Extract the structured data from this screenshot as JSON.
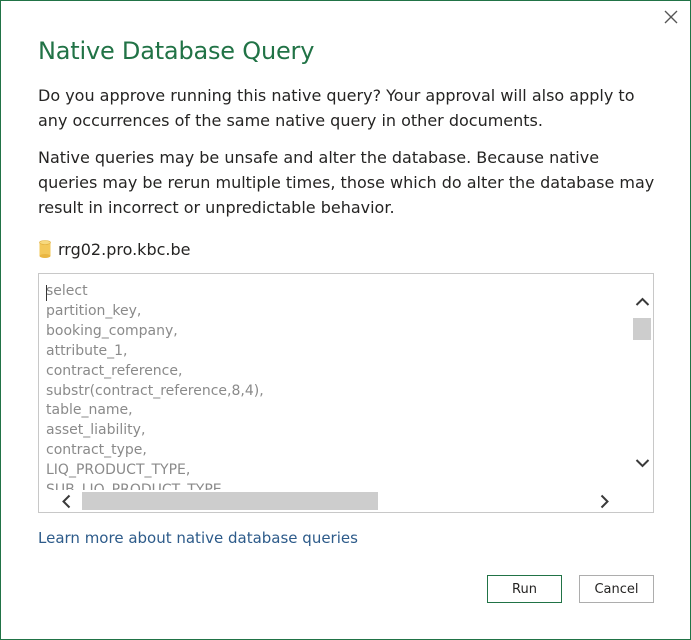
{
  "dialog": {
    "title": "Native Database Query",
    "approval_text": "Do you approve running this native query? Your approval will also apply to any occurrences of the same native query in other documents.",
    "warning_text": "Native queries may be unsafe and alter the database. Because native queries may be rerun multiple times, those which do alter the database may result in incorrect or unpredictable behavior.",
    "server": {
      "icon": "database-cylinder-icon",
      "label": "rrg02.pro.kbc.be"
    },
    "query": {
      "lines": [
        "select",
        "partition_key,",
        "booking_company,",
        "attribute_1,",
        "contract_reference,",
        "substr(contract_reference,8,4),",
        "table_name,",
        "asset_liability,",
        "contract_type,",
        "LIQ_PRODUCT_TYPE,",
        "SUB_LIQ_PRODUCT_TYPE"
      ]
    },
    "learn_more_link": "Learn more about native database queries",
    "run_label": "Run",
    "cancel_label": "Cancel",
    "close_icon": "close-icon"
  },
  "colors": {
    "accent": "#217346",
    "link": "#2d5b8a",
    "body_text": "#252423",
    "query_text": "#8a8a8a",
    "scrollbar_thumb": "#cdcdcd"
  }
}
